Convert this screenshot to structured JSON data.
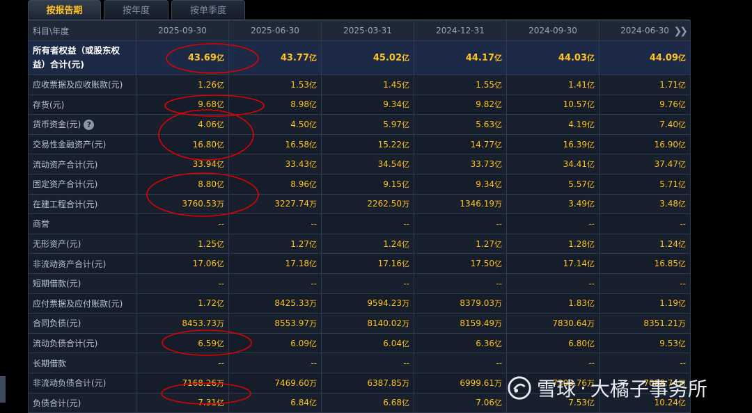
{
  "tabs": [
    {
      "label": "按报告期",
      "active": true
    },
    {
      "label": "按年度",
      "active": false
    },
    {
      "label": "按单季度",
      "active": false
    }
  ],
  "table": {
    "header_label": "科目\\年度",
    "columns": [
      "2025-09-30",
      "2025-06-30",
      "2025-03-31",
      "2024-12-31",
      "2024-09-30",
      "2024-06-30"
    ],
    "more_icon": "double-chevron-right-icon",
    "rows": [
      {
        "label": "所有者权益（或股东权益）合计(元)",
        "values": [
          [
            "43.69",
            "亿"
          ],
          [
            "43.77",
            "亿"
          ],
          [
            "45.02",
            "亿"
          ],
          [
            "44.17",
            "亿"
          ],
          [
            "44.03",
            "亿"
          ],
          [
            "44.09",
            "亿"
          ]
        ]
      },
      {
        "label": "应收票据及应收账款(元)",
        "values": [
          [
            "1.26",
            "亿"
          ],
          [
            "1.53",
            "亿"
          ],
          [
            "1.45",
            "亿"
          ],
          [
            "1.55",
            "亿"
          ],
          [
            "1.41",
            "亿"
          ],
          [
            "1.71",
            "亿"
          ]
        ]
      },
      {
        "label": "存货(元)",
        "values": [
          [
            "9.68",
            "亿"
          ],
          [
            "8.98",
            "亿"
          ],
          [
            "9.34",
            "亿"
          ],
          [
            "9.82",
            "亿"
          ],
          [
            "10.57",
            "亿"
          ],
          [
            "9.76",
            "亿"
          ]
        ]
      },
      {
        "label": "货币资金(元)",
        "help": "?",
        "values": [
          [
            "4.06",
            "亿"
          ],
          [
            "4.50",
            "亿"
          ],
          [
            "5.97",
            "亿"
          ],
          [
            "5.63",
            "亿"
          ],
          [
            "4.19",
            "亿"
          ],
          [
            "7.40",
            "亿"
          ]
        ]
      },
      {
        "label": "交易性金融资产(元)",
        "values": [
          [
            "16.80",
            "亿"
          ],
          [
            "16.58",
            "亿"
          ],
          [
            "15.22",
            "亿"
          ],
          [
            "14.77",
            "亿"
          ],
          [
            "16.39",
            "亿"
          ],
          [
            "16.90",
            "亿"
          ]
        ]
      },
      {
        "label": "流动资产合计(元)",
        "values": [
          [
            "33.94",
            "亿"
          ],
          [
            "33.43",
            "亿"
          ],
          [
            "34.54",
            "亿"
          ],
          [
            "33.73",
            "亿"
          ],
          [
            "34.41",
            "亿"
          ],
          [
            "37.47",
            "亿"
          ]
        ]
      },
      {
        "label": "固定资产合计(元)",
        "values": [
          [
            "8.80",
            "亿"
          ],
          [
            "8.96",
            "亿"
          ],
          [
            "9.15",
            "亿"
          ],
          [
            "9.34",
            "亿"
          ],
          [
            "5.57",
            "亿"
          ],
          [
            "5.71",
            "亿"
          ]
        ]
      },
      {
        "label": "在建工程合计(元)",
        "values": [
          [
            "3760.53",
            "万"
          ],
          [
            "3227.74",
            "万"
          ],
          [
            "2262.50",
            "万"
          ],
          [
            "1346.19",
            "万"
          ],
          [
            "3.49",
            "亿"
          ],
          [
            "3.48",
            "亿"
          ]
        ]
      },
      {
        "label": "商誉",
        "values": [
          [
            "--",
            ""
          ],
          [
            "--",
            ""
          ],
          [
            "--",
            ""
          ],
          [
            "--",
            ""
          ],
          [
            "--",
            ""
          ],
          [
            "--",
            ""
          ]
        ]
      },
      {
        "label": "无形资产(元)",
        "values": [
          [
            "1.25",
            "亿"
          ],
          [
            "1.27",
            "亿"
          ],
          [
            "1.24",
            "亿"
          ],
          [
            "1.27",
            "亿"
          ],
          [
            "1.28",
            "亿"
          ],
          [
            "1.24",
            "亿"
          ]
        ]
      },
      {
        "label": "非流动资产合计(元)",
        "values": [
          [
            "17.06",
            "亿"
          ],
          [
            "17.18",
            "亿"
          ],
          [
            "17.16",
            "亿"
          ],
          [
            "17.50",
            "亿"
          ],
          [
            "17.14",
            "亿"
          ],
          [
            "16.85",
            "亿"
          ]
        ]
      },
      {
        "label": "短期借款(元)",
        "values": [
          [
            "--",
            ""
          ],
          [
            "--",
            ""
          ],
          [
            "--",
            ""
          ],
          [
            "--",
            ""
          ],
          [
            "--",
            ""
          ],
          [
            "--",
            ""
          ]
        ]
      },
      {
        "label": "应付票据及应付账款(元)",
        "values": [
          [
            "1.72",
            "亿"
          ],
          [
            "8425.33",
            "万"
          ],
          [
            "9594.23",
            "万"
          ],
          [
            "8379.03",
            "万"
          ],
          [
            "1.83",
            "亿"
          ],
          [
            "1.19",
            "亿"
          ]
        ]
      },
      {
        "label": "合同负债(元)",
        "values": [
          [
            "8453.73",
            "万"
          ],
          [
            "8553.97",
            "万"
          ],
          [
            "8140.02",
            "万"
          ],
          [
            "8159.49",
            "万"
          ],
          [
            "7830.64",
            "万"
          ],
          [
            "8351.21",
            "万"
          ]
        ]
      },
      {
        "label": "流动负债合计(元)",
        "values": [
          [
            "6.59",
            "亿"
          ],
          [
            "6.09",
            "亿"
          ],
          [
            "6.04",
            "亿"
          ],
          [
            "6.36",
            "亿"
          ],
          [
            "6.80",
            "亿"
          ],
          [
            "9.53",
            "亿"
          ]
        ]
      },
      {
        "label": "长期借款",
        "values": [
          [
            "--",
            ""
          ],
          [
            "--",
            ""
          ],
          [
            "--",
            ""
          ],
          [
            "--",
            ""
          ],
          [
            "--",
            ""
          ],
          [
            "--",
            ""
          ]
        ]
      },
      {
        "label": "非流动负债合计(元)",
        "values": [
          [
            "7168.26",
            "万"
          ],
          [
            "7469.60",
            "万"
          ],
          [
            "6387.85",
            "万"
          ],
          [
            "6999.61",
            "万"
          ],
          [
            "7303.76",
            "万"
          ],
          [
            "7088.74",
            "万"
          ]
        ]
      },
      {
        "label": "负债合计(元)",
        "values": [
          [
            "7.31",
            "亿"
          ],
          [
            "6.84",
            "亿"
          ],
          [
            "6.68",
            "亿"
          ],
          [
            "7.06",
            "亿"
          ],
          [
            "7.53",
            "亿"
          ],
          [
            "10.24",
            "亿"
          ]
        ]
      }
    ]
  },
  "watermark": {
    "brand": "雪球",
    "separator": "·",
    "author": "大橘子事务所",
    "icon": "snowball-logo-icon"
  },
  "colors": {
    "value": "#ffc21f",
    "annotation": "#e00000",
    "header_bg": "#1f2836",
    "highlight_row_bg": "#1c2a47"
  }
}
